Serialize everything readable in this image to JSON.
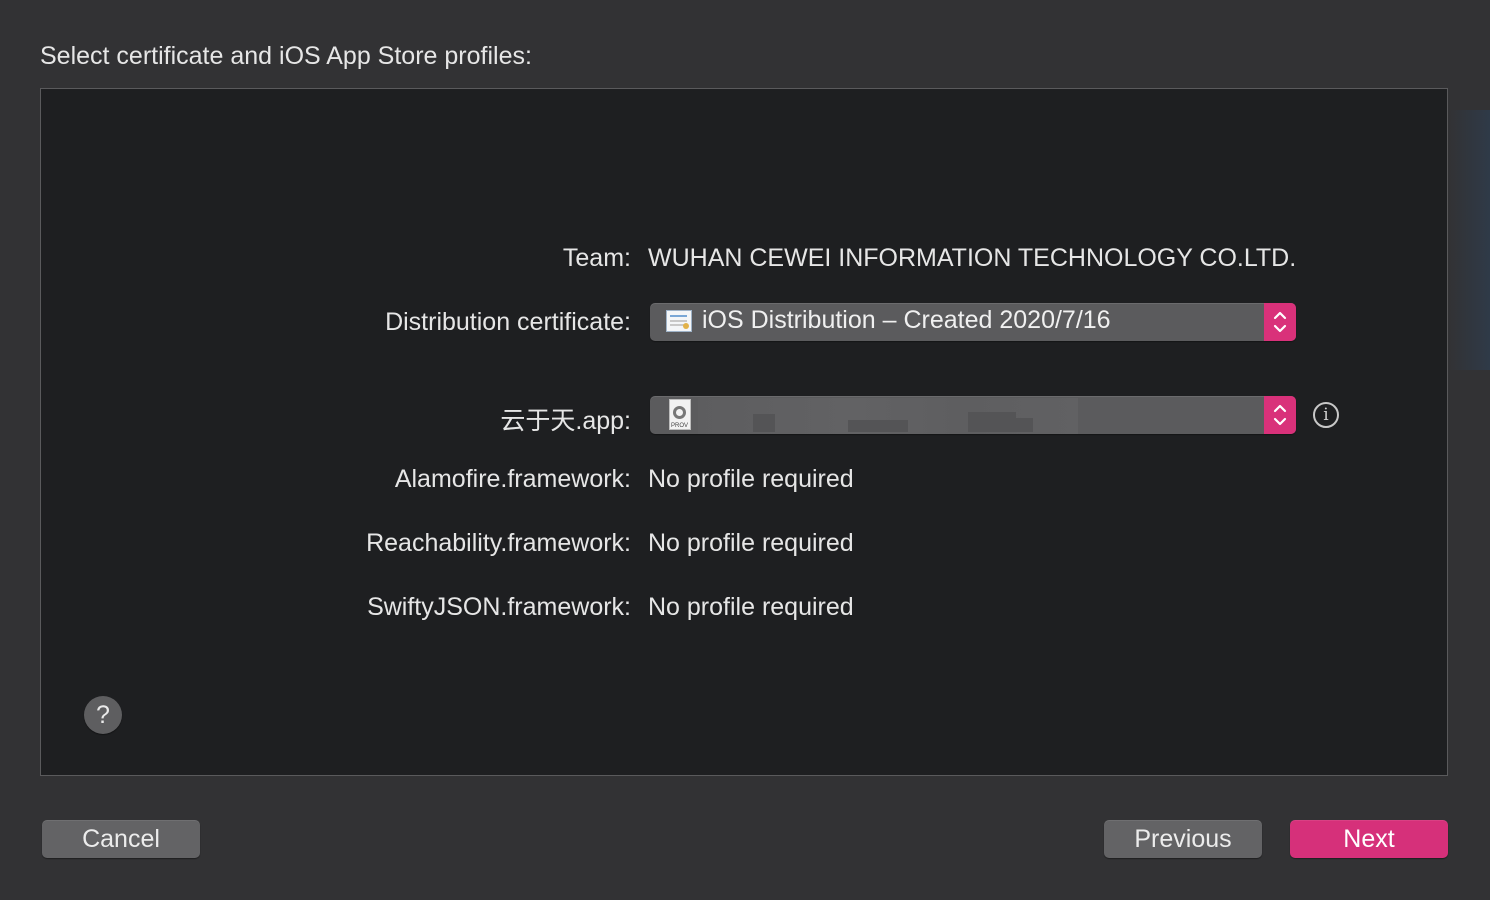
{
  "dialog": {
    "title": "Select certificate and iOS App Store profiles:"
  },
  "form": {
    "team_label": "Team:",
    "team_value": "WUHAN CEWEI INFORMATION TECHNOLOGY CO.LTD.",
    "certificate_label": "Distribution certificate:",
    "certificate_value": "iOS Distribution – Created 2020/7/16",
    "app_label": "云于天.app:",
    "app_profile_icon_text": "PROV",
    "frameworks": [
      {
        "label": "Alamofire.framework:",
        "value": "No profile required"
      },
      {
        "label": "Reachability.framework:",
        "value": "No profile required"
      },
      {
        "label": "SwiftyJSON.framework:",
        "value": "No profile required"
      }
    ]
  },
  "icons": {
    "info": "i",
    "help": "?"
  },
  "buttons": {
    "cancel": "Cancel",
    "previous": "Previous",
    "next": "Next"
  },
  "colors": {
    "accent": "#d6307a",
    "panel_background": "#1e1f21",
    "window_background": "#323234"
  }
}
